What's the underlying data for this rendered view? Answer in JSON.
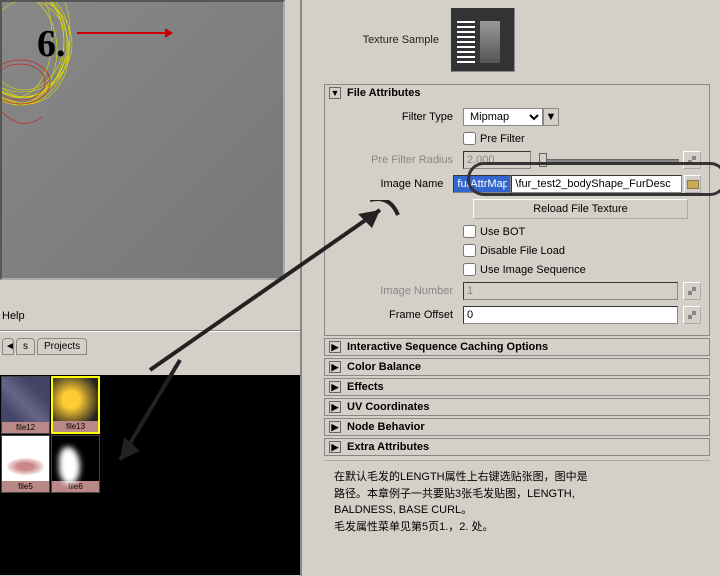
{
  "viewport": {
    "number_label": "6."
  },
  "left": {
    "help": "Help",
    "tabs": [
      "s",
      "Projects"
    ],
    "thumbs": [
      {
        "label": "file12"
      },
      {
        "label": "file13"
      },
      {
        "label": "file5"
      },
      {
        "label": "file6"
      }
    ]
  },
  "sample": {
    "label": "Texture Sample"
  },
  "file_attributes": {
    "title": "File Attributes",
    "filter_type": {
      "label": "Filter Type",
      "value": "Mipmap"
    },
    "pre_filter": {
      "label": "Pre Filter"
    },
    "pre_filter_radius": {
      "label": "Pre Filter Radius",
      "value": "2.000"
    },
    "image_name": {
      "label": "Image Name",
      "highlighted": "furAttrMap",
      "rest": "\\fur_test2_bodyShape_FurDesc"
    },
    "reload_btn": "Reload File Texture",
    "use_bot": "Use BOT",
    "disable_load": "Disable File Load",
    "use_seq": "Use Image Sequence",
    "image_number": {
      "label": "Image Number",
      "value": "1"
    },
    "frame_offset": {
      "label": "Frame Offset",
      "value": "0"
    }
  },
  "sections": [
    "Interactive Sequence Caching Options",
    "Color Balance",
    "Effects",
    "UV Coordinates",
    "Node Behavior",
    "Extra Attributes"
  ],
  "note": {
    "line1": "在默认毛发的LENGTH属性上右键选贴张图，图中是",
    "line2": "路径。本章例子一共要贴3张毛发贴图，LENGTH,",
    "line3": "BALDNESS, BASE CURL。",
    "line4": "毛发属性菜单见第5页1.，2. 处。"
  }
}
